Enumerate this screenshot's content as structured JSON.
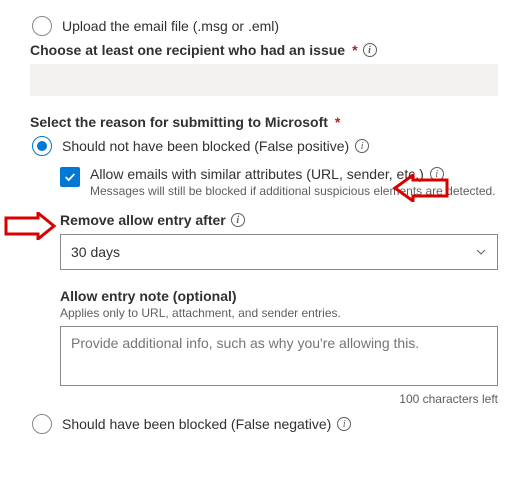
{
  "radio_upload": {
    "label": "Upload the email file (.msg or .eml)"
  },
  "recipient": {
    "label": "Choose at least one recipient who had an issue"
  },
  "reason": {
    "label": "Select the reason for submitting to Microsoft",
    "false_positive": "Should not have been blocked (False positive)",
    "false_negative": "Should have been blocked (False negative)"
  },
  "allow": {
    "label": "Allow emails with similar attributes (URL, sender, etc.)",
    "desc": "Messages will still be blocked if additional suspicious elements are detected."
  },
  "remove_after": {
    "label": "Remove allow entry after",
    "value": "30 days"
  },
  "note": {
    "label": "Allow entry note (optional)",
    "desc": "Applies only to URL, attachment, and sender entries.",
    "placeholder": "Provide additional info, such as why you're allowing this.",
    "chars_left": "100 characters left"
  }
}
